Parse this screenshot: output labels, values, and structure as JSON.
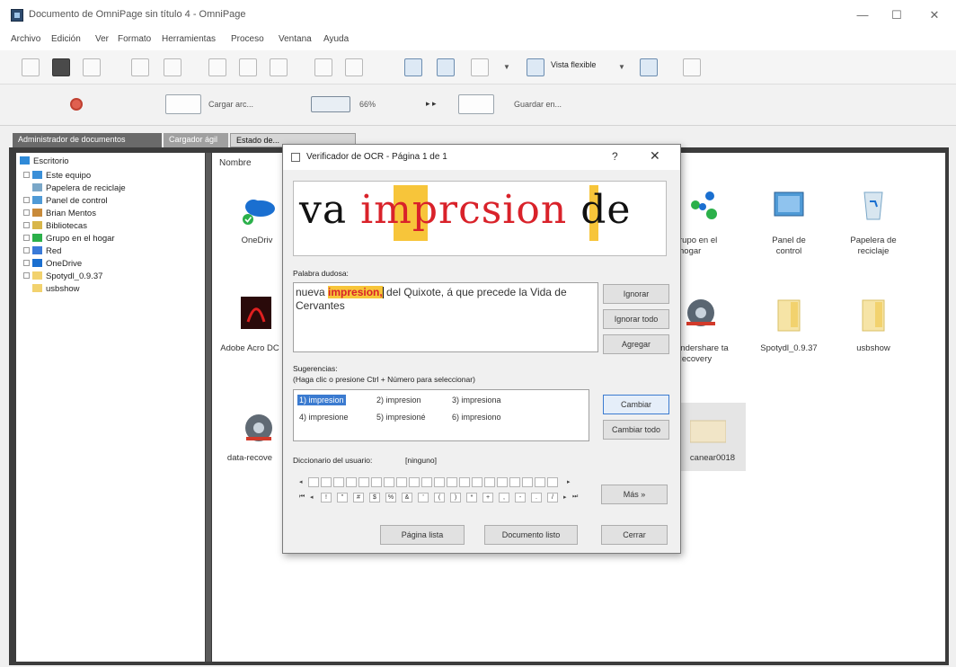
{
  "window": {
    "title": "Documento de OmniPage sin título 4 - OmniPage",
    "controls": [
      "—",
      "☐",
      "✕"
    ]
  },
  "menu": [
    "Archivo",
    "Edición",
    "Ver",
    "Formato",
    "Herramientas",
    "Proceso",
    "Ventana",
    "Ayuda"
  ],
  "toolbar": {
    "view_mode": "Vista flexible",
    "load_label": "Cargar arc...",
    "zoom": "66%",
    "save_label": "Guardar en..."
  },
  "tabs": [
    "Administrador de documentos",
    "Cargador ágil",
    "Estado de..."
  ],
  "tree": [
    {
      "label": "Escritorio",
      "level": 0,
      "icon": "desktop-icon",
      "color": "#2f8ad8"
    },
    {
      "label": "Este equipo",
      "level": 1,
      "icon": "computer-icon",
      "color": "#3a8fd8"
    },
    {
      "label": "Papelera de reciclaje",
      "level": 1,
      "icon": "recycle-bin-icon",
      "color": "#7aa7c8"
    },
    {
      "label": "Panel de control",
      "level": 1,
      "icon": "control-panel-icon",
      "color": "#4f9ad6"
    },
    {
      "label": "Brian Mentos",
      "level": 1,
      "icon": "user-icon",
      "color": "#c88a3a"
    },
    {
      "label": "Bibliotecas",
      "level": 1,
      "icon": "library-icon",
      "color": "#d8b64a"
    },
    {
      "label": "Grupo en el hogar",
      "level": 1,
      "icon": "homegroup-icon",
      "color": "#2bb04a"
    },
    {
      "label": "Red",
      "level": 1,
      "icon": "network-icon",
      "color": "#3a7ad8"
    },
    {
      "label": "OneDrive",
      "level": 1,
      "icon": "onedrive-icon",
      "color": "#1a6fd0"
    },
    {
      "label": "Spotydl_0.9.37",
      "level": 1,
      "icon": "folder-icon",
      "color": "#f2d26e"
    },
    {
      "label": "usbshow",
      "level": 1,
      "icon": "folder-icon",
      "color": "#f2d26e"
    }
  ],
  "files": {
    "column_header": "Nombre",
    "items": [
      {
        "label": "OneDriv",
        "icon": "onedrive-icon"
      },
      {
        "label": "Adobe Acro DC",
        "icon": "adobe-acrobat-icon"
      },
      {
        "label": "data-recove",
        "icon": "data-recovery-icon"
      },
      {
        "label": "rupo en el hogar",
        "icon": "homegroup-icon"
      },
      {
        "label": "Panel de control",
        "icon": "control-panel-icon"
      },
      {
        "label": "Papelera de reciclaje",
        "icon": "recycle-bin-icon"
      },
      {
        "label": "ondershare ta Recovery",
        "icon": "wondershare-icon"
      },
      {
        "label": "Spotydl_0.9.37",
        "icon": "folder-icon"
      },
      {
        "label": "usbshow",
        "icon": "folder-icon"
      },
      {
        "label": "canear0018",
        "icon": "scan-image-icon"
      }
    ]
  },
  "dialog": {
    "title": "Verificador de OCR - Página 1 de 1",
    "help": "?",
    "close": "✕",
    "preview_prefix": "va ",
    "preview_word": "imprcsion",
    "preview_suffix": " de",
    "doubtful_label": "Palabra dudosa:",
    "doubtful_before": "nueva ",
    "doubtful_word": "impresion,",
    "doubtful_after": " del Quixote, á que precede la Vida de Cervantes",
    "suggestions_label": "Sugerencias:",
    "suggestions_hint": "(Haga clic o presione Ctrl + Número para seleccionar)",
    "suggestions": [
      "1) impresion",
      "2) impresion",
      "3) impresiona",
      "4) impresione",
      "5) impresioné",
      "6) impresiono"
    ],
    "user_dict_label": "Diccionario del usuario:",
    "user_dict_value": "[ninguno]",
    "char_row2": [
      "!",
      "\"",
      "#",
      "$",
      "%",
      "&",
      "'",
      "(",
      ")",
      "*",
      "+",
      ",",
      "-",
      ".",
      "/"
    ],
    "buttons": {
      "ignore": "Ignorar",
      "ignore_all": "Ignorar todo",
      "add": "Agregar",
      "change": "Cambiar",
      "change_all": "Cambiar todo",
      "more": "Más »",
      "page_done": "Página lista",
      "doc_done": "Documento listo",
      "close": "Cerrar"
    }
  }
}
